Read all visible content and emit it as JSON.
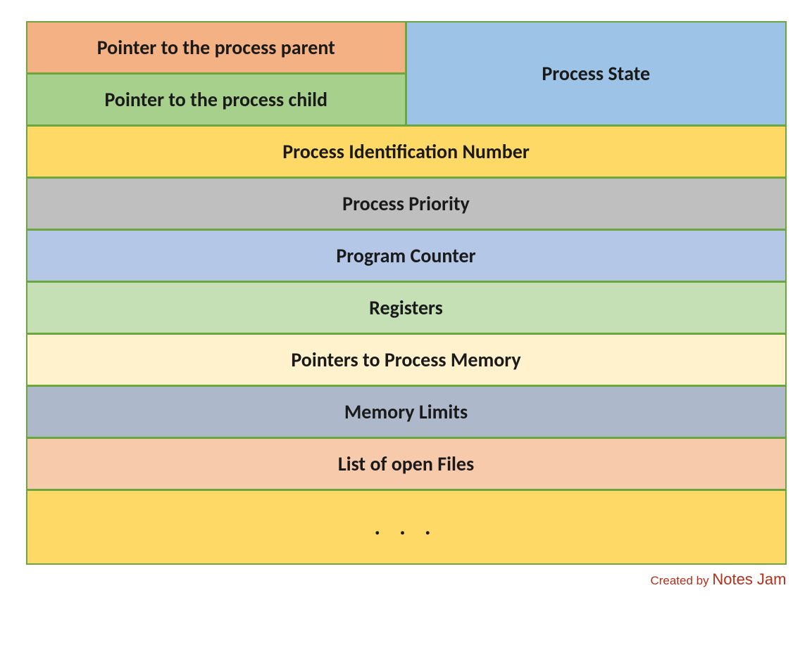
{
  "pcb": {
    "pointer_parent": "Pointer to the process parent",
    "pointer_child": "Pointer to the process child",
    "state": "Process State",
    "pid": "Process Identification Number",
    "priority": "Process Priority",
    "program_counter": "Program Counter",
    "registers": "Registers",
    "memory_pointers": "Pointers to Process Memory",
    "memory_limits": "Memory Limits",
    "open_files": "List of open Files",
    "more": ". . ."
  },
  "credit": {
    "prefix": "Created by ",
    "name": "Notes Jam"
  }
}
